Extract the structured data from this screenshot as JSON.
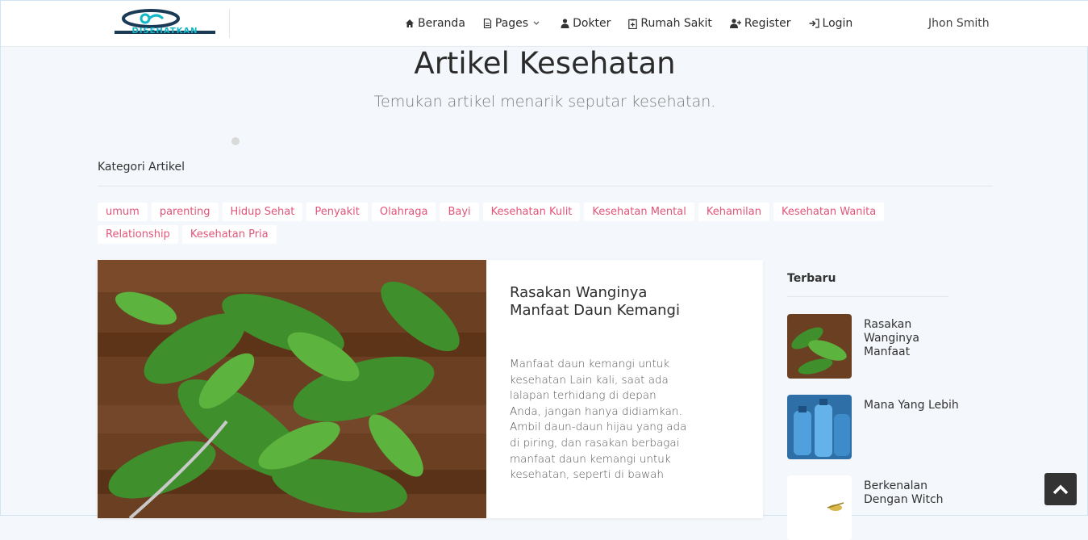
{
  "brand": {
    "logo_text": "DISEHATKAN",
    "accent": "#0fb7c7",
    "chip_color": "#e2557a"
  },
  "nav": {
    "items": [
      {
        "label": "Beranda",
        "icon": "home-icon"
      },
      {
        "label": "Pages",
        "icon": "page-icon",
        "dropdown": true
      },
      {
        "label": "Dokter",
        "icon": "doctor-icon"
      },
      {
        "label": "Rumah Sakit",
        "icon": "hospital-icon"
      },
      {
        "label": "Register",
        "icon": "user-plus-icon"
      },
      {
        "label": "Login",
        "icon": "sign-in-icon"
      }
    ],
    "user": "Jhon Smith"
  },
  "hero": {
    "title": "Artikel Kesehatan",
    "subtitle": "Temukan artikel menarik seputar kesehatan."
  },
  "categories": {
    "heading": "Kategori Artikel",
    "items": [
      "umum",
      "parenting",
      "Hidup Sehat",
      "Penyakit",
      "Olahraga",
      "Bayi",
      "Kesehatan Kulit",
      "Kesehatan Mental",
      "Kehamilan",
      "Kesehatan Wanita",
      "Relationship",
      "Kesehatan Pria"
    ]
  },
  "featured": {
    "title": "Rasakan Wanginya Manfaat Daun Kemangi",
    "excerpt": "Manfaat daun kemangi untuk kesehatan Lain kali, saat ada lalapan terhidang di depan Anda, jangan hanya didiamkan. Ambil daun-daun hijau yang ada di piring, dan rasakan berbagai manfaat daun kemangi untuk kesehatan, seperti di bawah"
  },
  "sidebar": {
    "title": "Terbaru",
    "items": [
      {
        "label": "Rasakan Wanginya Manfaat"
      },
      {
        "label": "Mana Yang Lebih"
      },
      {
        "label": "Berkenalan Dengan Witch"
      }
    ]
  }
}
